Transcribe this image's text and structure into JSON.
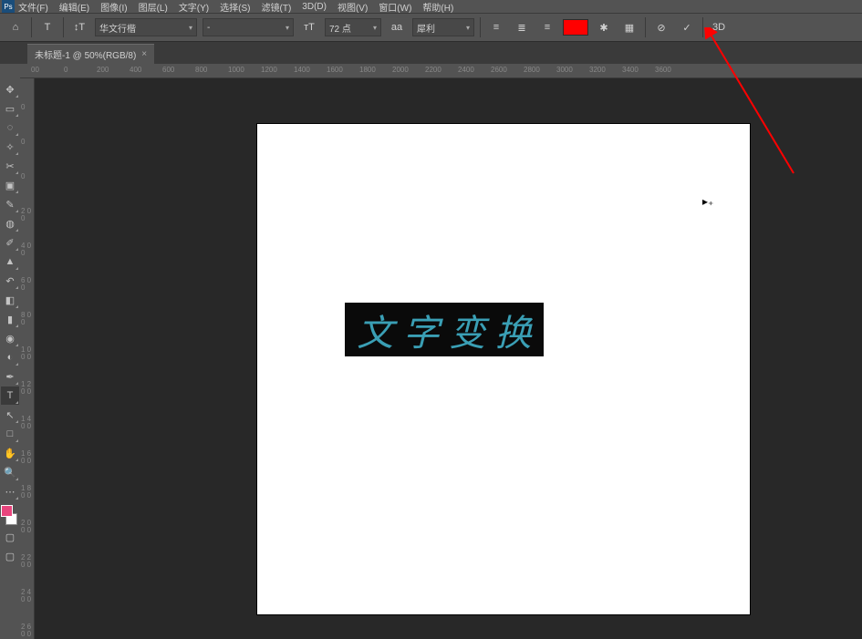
{
  "menubar": {
    "items": [
      "文件(F)",
      "编辑(E)",
      "图像(I)",
      "图层(L)",
      "文字(Y)",
      "选择(S)",
      "滤镜(T)",
      "3D(D)",
      "视图(V)",
      "窗口(W)",
      "帮助(H)"
    ]
  },
  "options": {
    "font_family": "华文行楷",
    "font_style": "-",
    "font_size": "72 点",
    "aa_label": "aa",
    "aa_mode": "犀利",
    "color": "#ff0000",
    "commit_label": "✓",
    "cancel_label": "⊘",
    "threed_label": "3D"
  },
  "tab": {
    "title": "未标题-1 @ 50%(RGB/8)",
    "close": "×"
  },
  "ruler_top": [
    "00",
    "0",
    "200",
    "400",
    "600",
    "800",
    "1000",
    "1200",
    "1400",
    "1600",
    "1800",
    "2000",
    "2200",
    "2400",
    "2600",
    "2800",
    "3000",
    "3200",
    "3400",
    "3600"
  ],
  "ruler_left": [
    "0",
    "0",
    "0",
    "0",
    "2 0 0",
    "4 0 0",
    "6 0 0",
    "8 0 0",
    "1 0 0 0",
    "1 2 0 0",
    "1 4 0 0",
    "1 6 0 0",
    "1 8 0 0",
    "2 0 0 0",
    "2 2 0 0",
    "2 4 0 0",
    "2 6 0 0"
  ],
  "canvas": {
    "text_chars": [
      "文",
      "字",
      "变",
      "换"
    ]
  },
  "tools": [
    {
      "name": "move-tool",
      "glyph": "✥"
    },
    {
      "name": "marquee-tool",
      "glyph": "▭"
    },
    {
      "name": "lasso-tool",
      "glyph": "◌"
    },
    {
      "name": "magic-wand-tool",
      "glyph": "✧"
    },
    {
      "name": "crop-tool",
      "glyph": "✂"
    },
    {
      "name": "frame-tool",
      "glyph": "▣"
    },
    {
      "name": "eyedropper-tool",
      "glyph": "✎"
    },
    {
      "name": "healing-tool",
      "glyph": "◍"
    },
    {
      "name": "brush-tool",
      "glyph": "✐"
    },
    {
      "name": "stamp-tool",
      "glyph": "▲"
    },
    {
      "name": "history-brush-tool",
      "glyph": "↶"
    },
    {
      "name": "eraser-tool",
      "glyph": "◧"
    },
    {
      "name": "gradient-tool",
      "glyph": "▮"
    },
    {
      "name": "blur-tool",
      "glyph": "◉"
    },
    {
      "name": "dodge-tool",
      "glyph": "◐"
    },
    {
      "name": "pen-tool",
      "glyph": "✒"
    },
    {
      "name": "type-tool",
      "glyph": "T",
      "active": true
    },
    {
      "name": "path-select-tool",
      "glyph": "↖"
    },
    {
      "name": "shape-tool",
      "glyph": "□"
    },
    {
      "name": "hand-tool",
      "glyph": "✋"
    },
    {
      "name": "zoom-tool",
      "glyph": "🔍"
    },
    {
      "name": "more-tool",
      "glyph": "⋯"
    }
  ]
}
